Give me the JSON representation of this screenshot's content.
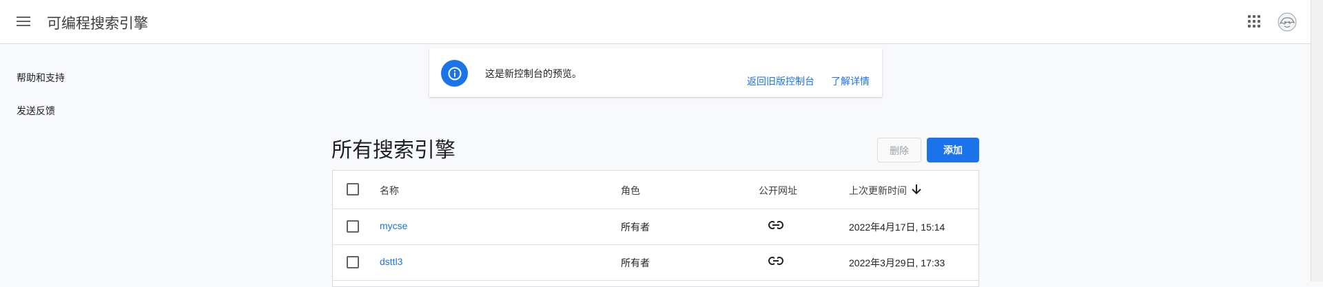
{
  "header": {
    "app_title": "可编程搜索引擎",
    "menu_icon": "hamburger-menu-icon",
    "apps_icon": "apps-grid-icon",
    "avatar_icon": "account-avatar"
  },
  "sidebar": {
    "items": [
      {
        "label": "帮助和支持"
      },
      {
        "label": "发送反馈"
      }
    ]
  },
  "banner": {
    "icon": "info-icon",
    "message": "这是新控制台的预览。",
    "back_link": "返回旧版控制台",
    "learn_more_link": "了解详情"
  },
  "main": {
    "title": "所有搜索引擎",
    "delete_label": "删除",
    "add_label": "添加"
  },
  "table": {
    "columns": {
      "name": "名称",
      "role": "角色",
      "public_url": "公开网址",
      "last_updated": "上次更新时间"
    },
    "sort_icon": "arrow-down-icon",
    "rows": [
      {
        "name": "mycse",
        "role": "所有者",
        "url_icon": "link-icon",
        "last_updated": "2022年4月17日, 15:14"
      },
      {
        "name": "dsttl3",
        "role": "所有者",
        "url_icon": "link-icon",
        "last_updated": "2022年3月29日, 17:33"
      }
    ]
  },
  "colors": {
    "accent": "#1a73e8",
    "background": "#f8f9fa",
    "border": "#dadce0"
  }
}
